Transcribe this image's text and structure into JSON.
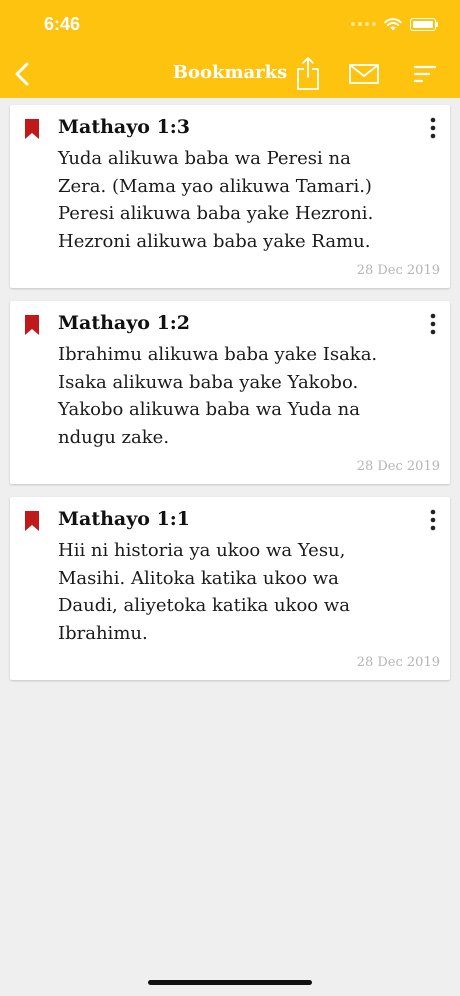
{
  "status_bar": {
    "time": "6:46"
  },
  "header": {
    "title": "Bookmarks"
  },
  "theme": {
    "accent": "#fec30f",
    "bookmark_color": "#c0191b"
  },
  "bookmarks": [
    {
      "reference": "Mathayo 1:3",
      "lines": [
        "Yuda alikuwa baba wa Peresi na",
        "Zera. (Mama yao alikuwa Tamari.)",
        "Peresi alikuwa baba yake Hezroni.",
        "Hezroni alikuwa baba yake Ramu."
      ],
      "date": "28 Dec 2019"
    },
    {
      "reference": "Mathayo 1:2",
      "lines": [
        "Ibrahimu alikuwa baba yake Isaka.",
        "Isaka alikuwa baba yake Yakobo.",
        "Yakobo alikuwa baba wa Yuda na",
        "ndugu zake."
      ],
      "date": "28 Dec 2019"
    },
    {
      "reference": "Mathayo 1:1",
      "lines": [
        "Hii ni historia ya ukoo wa Yesu,",
        "Masihi. Alitoka katika ukoo wa",
        "Daudi, aliyetoka katika ukoo wa",
        "Ibrahimu."
      ],
      "date": "28 Dec 2019"
    }
  ]
}
